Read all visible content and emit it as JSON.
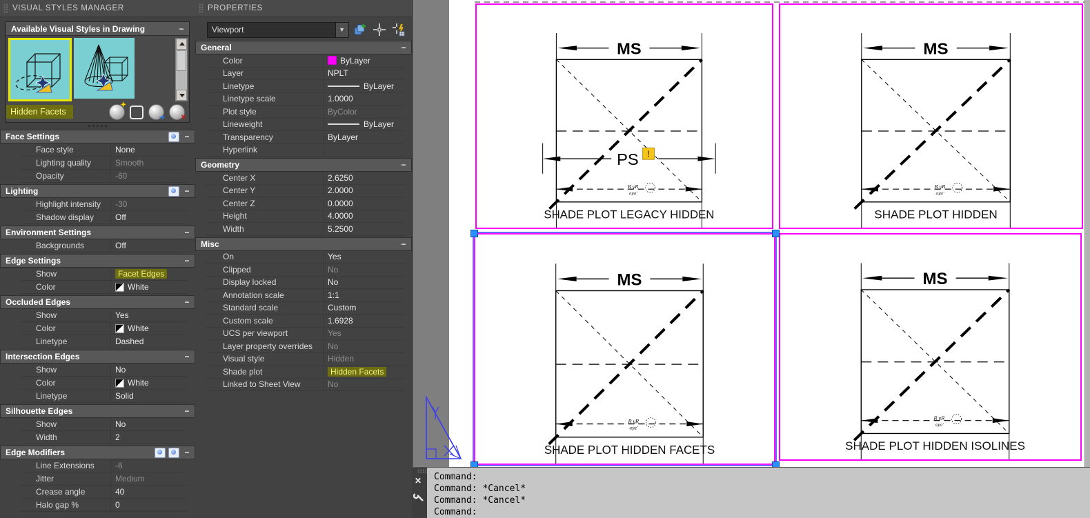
{
  "ui": {
    "collapse_glyph": "−",
    "dropdown_arrow": "▼"
  },
  "colors": {
    "viewport_border": "#ff00ff",
    "selection_blue": "#6262ff",
    "grip_blue": "#2a8fff",
    "highlight_bg": "#6d6d12",
    "highlight_text": "#f2f27c",
    "thumbnail_teal": "#79cfd1",
    "warning_yellow": "#f5c518"
  },
  "vsm": {
    "title": "VISUAL STYLES MANAGER",
    "panel_title": "Available Visual Styles in Drawing",
    "selected_style_name": "Hidden Facets",
    "tool_icons": [
      "create-visual-style-icon",
      "apply-visual-style-icon",
      "export-visual-style-icon",
      "delete-visual-style-icon"
    ],
    "sections": [
      {
        "title": "Face Settings",
        "icons": [
          "face-highlight-icon"
        ],
        "rows": [
          {
            "label": "Face style",
            "value": "None"
          },
          {
            "label": "Lighting quality",
            "value": "Smooth",
            "muted": true
          },
          {
            "label": "Opacity",
            "value": "-60",
            "muted": true
          }
        ]
      },
      {
        "title": "Lighting",
        "icons": [
          "lighting-highlight-icon"
        ],
        "rows": [
          {
            "label": "Highlight intensity",
            "value": "-30",
            "muted": true
          },
          {
            "label": "Shadow display",
            "value": "Off"
          }
        ]
      },
      {
        "title": "Environment Settings",
        "rows": [
          {
            "label": "Backgrounds",
            "value": "Off"
          }
        ]
      },
      {
        "title": "Edge Settings",
        "rows": [
          {
            "label": "Show",
            "value": "Facet Edges",
            "hl": true
          },
          {
            "label": "Color",
            "value": "White",
            "swatch": "bw"
          }
        ]
      },
      {
        "title": "Occluded Edges",
        "rows": [
          {
            "label": "Show",
            "value": "Yes"
          },
          {
            "label": "Color",
            "value": "White",
            "swatch": "bw"
          },
          {
            "label": "Linetype",
            "value": "Dashed"
          }
        ]
      },
      {
        "title": "Intersection Edges",
        "rows": [
          {
            "label": "Show",
            "value": "No"
          },
          {
            "label": "Color",
            "value": "White",
            "swatch": "bw"
          },
          {
            "label": "Linetype",
            "value": "Solid"
          }
        ]
      },
      {
        "title": "Silhouette Edges",
        "rows": [
          {
            "label": "Show",
            "value": "No"
          },
          {
            "label": "Width",
            "value": "2"
          }
        ]
      },
      {
        "title": "Edge Modifiers",
        "icons": [
          "line-extensions-icon",
          "jitter-icon"
        ],
        "rows": [
          {
            "label": "Line Extensions",
            "value": "-6",
            "muted": true
          },
          {
            "label": "Jitter",
            "value": "Medium",
            "muted": true
          },
          {
            "label": "Crease angle",
            "value": "40"
          },
          {
            "label": "Halo gap %",
            "value": "0"
          }
        ]
      }
    ]
  },
  "properties": {
    "title": "PROPERTIES",
    "selector_value": "Viewport",
    "sections": [
      {
        "title": "General",
        "rows": [
          {
            "label": "Color",
            "value": "ByLayer",
            "swatch": "mag"
          },
          {
            "label": "Layer",
            "value": "NPLT"
          },
          {
            "label": "Linetype",
            "value": "ByLayer",
            "line": true
          },
          {
            "label": "Linetype scale",
            "value": "1.0000"
          },
          {
            "label": "Plot style",
            "value": "ByColor",
            "muted": true
          },
          {
            "label": "Lineweight",
            "value": "ByLayer",
            "line": true
          },
          {
            "label": "Transparency",
            "value": "ByLayer"
          },
          {
            "label": "Hyperlink",
            "value": ""
          }
        ]
      },
      {
        "title": "Geometry",
        "rows": [
          {
            "label": "Center X",
            "value": "2.6250"
          },
          {
            "label": "Center Y",
            "value": "2.0000"
          },
          {
            "label": "Center Z",
            "value": "0.0000"
          },
          {
            "label": "Height",
            "value": "4.0000"
          },
          {
            "label": "Width",
            "value": "5.2500"
          }
        ]
      },
      {
        "title": "Misc",
        "rows": [
          {
            "label": "On",
            "value": "Yes"
          },
          {
            "label": "Clipped",
            "value": "No",
            "muted": true
          },
          {
            "label": "Display locked",
            "value": "No"
          },
          {
            "label": "Annotation scale",
            "value": "1:1"
          },
          {
            "label": "Standard scale",
            "value": "Custom"
          },
          {
            "label": "Custom scale",
            "value": "1.6928"
          },
          {
            "label": "UCS per viewport",
            "value": "Yes",
            "muted": true
          },
          {
            "label": "Layer property overrides",
            "value": "No",
            "muted": true
          },
          {
            "label": "Visual style",
            "value": "Hidden",
            "muted": true
          },
          {
            "label": "Shade plot",
            "value": "Hidden Facets",
            "hl": true
          },
          {
            "label": "Linked to Sheet View",
            "value": "No",
            "muted": true
          }
        ]
      }
    ]
  },
  "drawing": {
    "dim_ms": "MS",
    "dim_ps": "PS",
    "ps_warning": "!",
    "viewports": [
      {
        "name": "shade-plot-legacy-hidden",
        "label": "SHADE PLOT LEGACY HIDDEN",
        "has_ps": true,
        "selected": false
      },
      {
        "name": "shade-plot-hidden",
        "label": "SHADE PLOT HIDDEN",
        "has_ps": false,
        "selected": false
      },
      {
        "name": "shade-plot-hidden-facets",
        "label": "SHADE PLOT HIDDEN FACETS",
        "has_ps": false,
        "selected": true
      },
      {
        "name": "shade-plot-hidden-isolines",
        "label": "SHADE PLOT HIDDEN ISOLINES",
        "has_ps": false,
        "selected": false
      }
    ]
  },
  "command": {
    "lines": [
      "Command:",
      "Command: *Cancel*",
      "Command: *Cancel*",
      "Command:"
    ]
  }
}
